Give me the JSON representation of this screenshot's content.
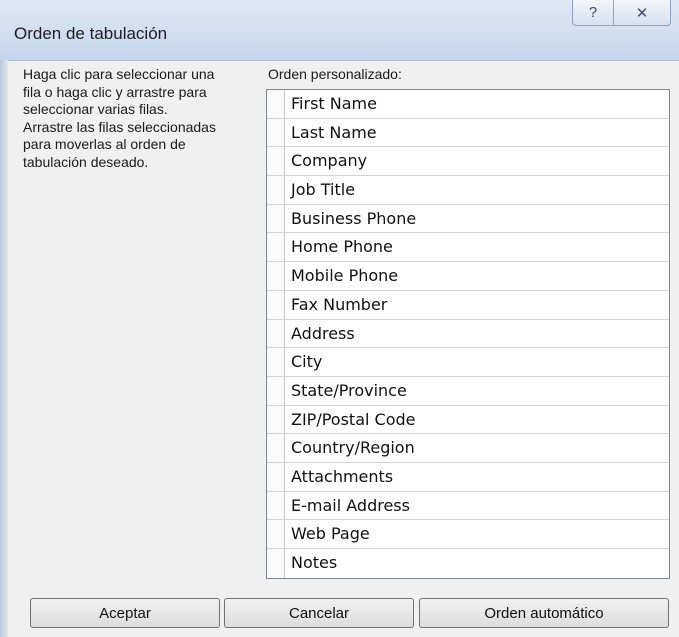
{
  "dialog": {
    "title": "Orden de tabulación",
    "help_icon": "?",
    "close_icon": "✕"
  },
  "instructions": {
    "lines": [
      "Haga clic para seleccionar una",
      "fila o haga clic y arrastre para",
      "seleccionar varias filas.",
      "Arrastre las filas seleccionadas",
      "para moverlas al orden de",
      "tabulación deseado."
    ]
  },
  "list": {
    "label": "Orden personalizado:",
    "items": [
      "First Name",
      "Last Name",
      "Company",
      "Job Title",
      "Business Phone",
      "Home Phone",
      "Mobile Phone",
      "Fax Number",
      "Address",
      "City",
      "State/Province",
      "ZIP/Postal Code",
      "Country/Region",
      "Attachments",
      "E-mail Address",
      "Web Page",
      "Notes"
    ]
  },
  "buttons": {
    "ok": "Aceptar",
    "cancel": "Cancelar",
    "auto": "Orden automático"
  }
}
